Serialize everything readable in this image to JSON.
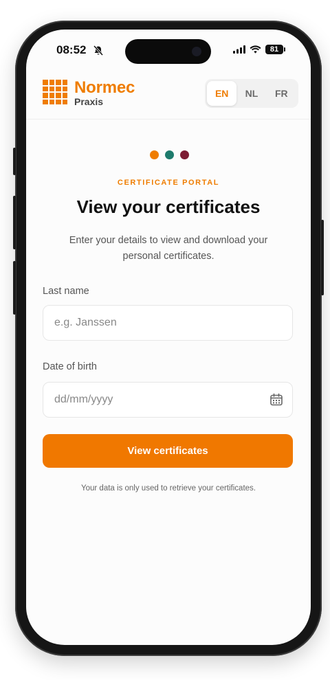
{
  "status_bar": {
    "time": "08:52",
    "battery": "81"
  },
  "header": {
    "brand_name": "Normec",
    "brand_sub": "Praxis",
    "languages": [
      {
        "code": "EN",
        "active": true
      },
      {
        "code": "NL",
        "active": false
      },
      {
        "code": "FR",
        "active": false
      }
    ]
  },
  "decor_dots": [
    "#ef7d00",
    "#1e7b6c",
    "#7d1c34"
  ],
  "hero": {
    "eyebrow": "CERTIFICATE PORTAL",
    "title": "View your certificates",
    "description": "Enter your details to view and download your personal certificates."
  },
  "form": {
    "last_name_label": "Last name",
    "last_name_value": "",
    "last_name_placeholder": "e.g. Janssen",
    "dob_label": "Date of birth",
    "dob_value": "",
    "dob_placeholder": "dd/mm/yyyy",
    "submit_label": "View certificates",
    "privacy_note": "Your data is only used to retrieve your certificates."
  },
  "colors": {
    "accent": "#ef7d00",
    "button": "#f07800"
  },
  "icons": [
    "bell-off-icon",
    "signal-icon",
    "wifi-icon",
    "battery-icon",
    "calendar-icon"
  ]
}
